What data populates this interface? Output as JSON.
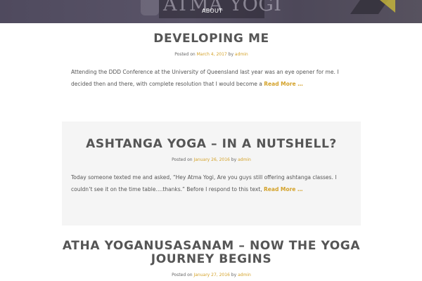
{
  "site": {
    "logo_text": "ATMA YOGI",
    "nav": {
      "about": "ABOUT"
    }
  },
  "posts": [
    {
      "title": "DEVELOPING ME",
      "posted_on": "Posted on",
      "date": "March 4, 2017",
      "by": "by",
      "author": "admin",
      "excerpt": "Attending the DDD Conference at the University of Queensland last year was an eye opener for me.  I decided then and there, with complete resolution that I would become a",
      "read_more": "Read More …"
    },
    {
      "title": "ASHTANGA YOGA – IN A NUTSHELL?",
      "posted_on": "Posted on",
      "date": "January 26, 2016",
      "by": "by",
      "author": "admin",
      "excerpt": "Today someone texted me and asked, “Hey Atma Yogi, Are you guys still offering ashtanga classes.  I couldn’t see it on the time table….thanks.”  Before I respond to this text,",
      "read_more": "Read More …"
    },
    {
      "title": "ATHA YOGANUSASANAM – NOW THE YOGA JOURNEY BEGINS",
      "posted_on": "Posted on",
      "date": "January 27, 2016",
      "by": "by",
      "author": "admin"
    }
  ],
  "colors": {
    "accent": "#d4a229",
    "header_bg": "#524d5e",
    "text": "#555555",
    "shaded_bg": "#f5f5f5"
  }
}
